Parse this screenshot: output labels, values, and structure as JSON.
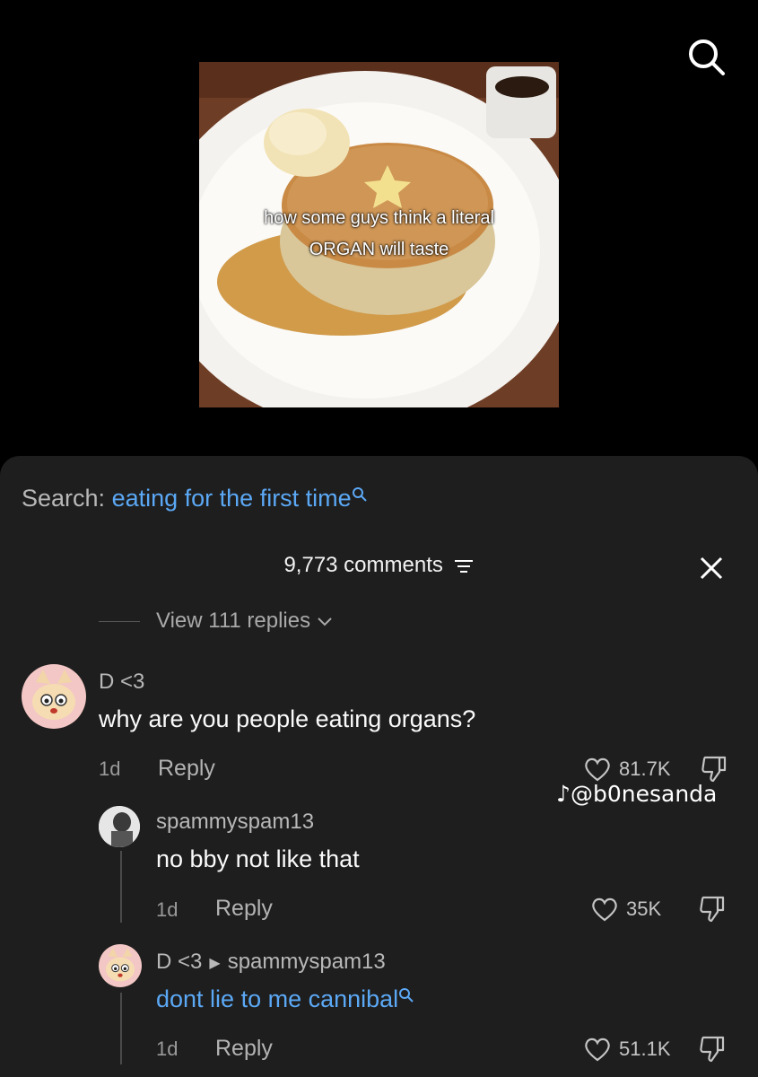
{
  "video": {
    "overlay_line1": "how some guys think a literal",
    "overlay_line2": "ORGAN will taste"
  },
  "search_bar": {
    "label": "Search:",
    "query": "eating for the first time"
  },
  "comments_header": {
    "count_label": "9,773 comments"
  },
  "view_replies": "View 111 replies",
  "comments": [
    {
      "user": "D <3",
      "text": "why are you people eating organs?",
      "age": "1d",
      "reply_label": "Reply",
      "likes": "81.7K"
    },
    {
      "user": "spammyspam13",
      "text": "no bby not like that",
      "age": "1d",
      "reply_label": "Reply",
      "likes": "35K"
    },
    {
      "user": "D <3",
      "reply_to": "spammyspam13",
      "text": "dont lie to me cannibal",
      "age": "1d",
      "reply_label": "Reply",
      "likes": "51.1K"
    }
  ],
  "watermark": "@b0nesanda",
  "colors": {
    "accent_blue": "#5ba8f5",
    "sheet_bg": "#1e1e1e"
  }
}
